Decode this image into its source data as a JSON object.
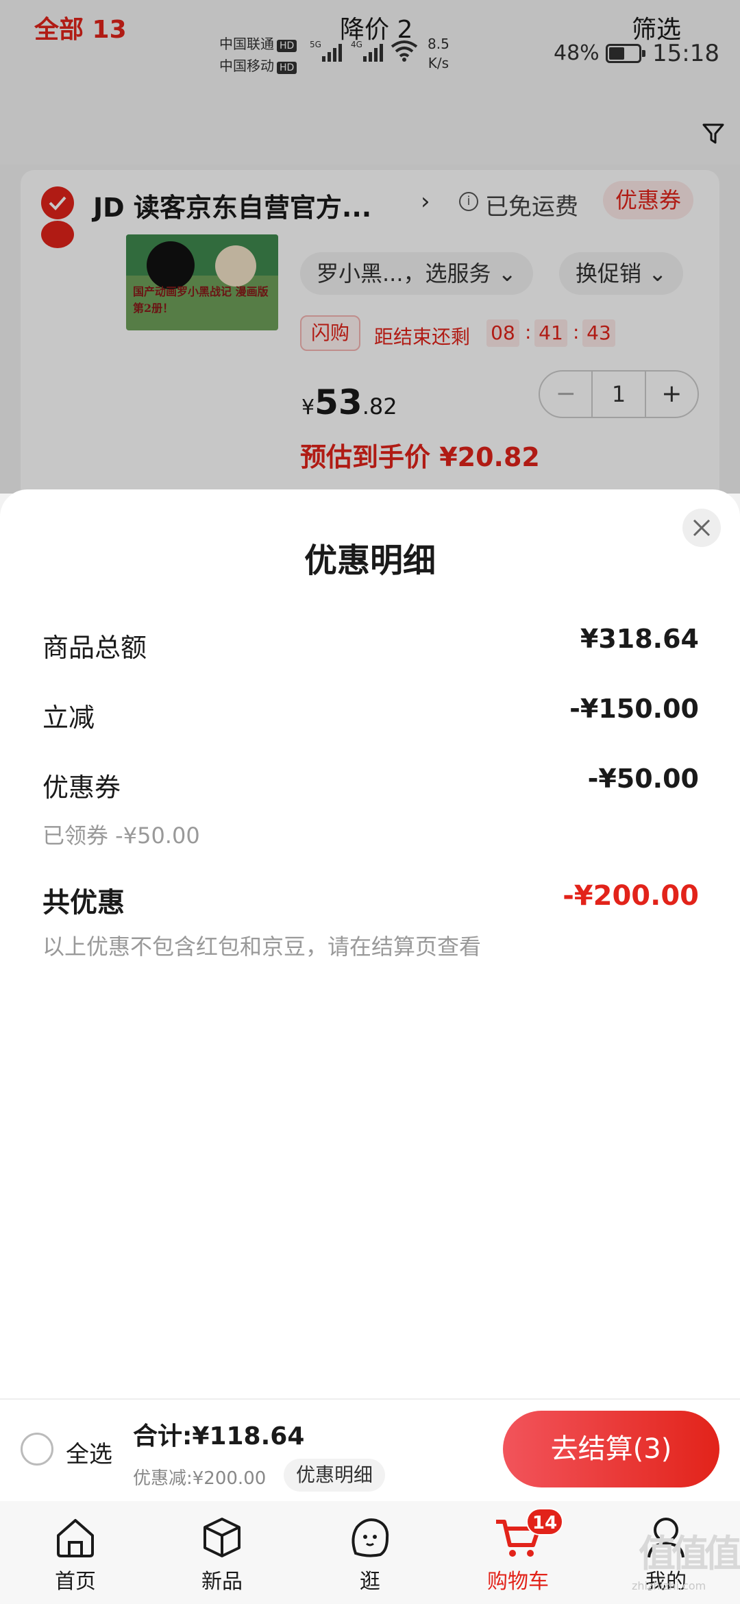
{
  "status_bar": {
    "carrier_1": "中国联通",
    "carrier_2": "中国移动",
    "hd": "HD",
    "net_1": "5G",
    "net_2": "4G",
    "speed_value": "8.5",
    "speed_unit": "K/s",
    "battery": "48%",
    "time": "15:18"
  },
  "tabs": {
    "all": "全部 13",
    "price_drop": "降价 2",
    "filter": "筛选"
  },
  "store": {
    "logo": "JD",
    "name": "读客京东自营官方...",
    "arrow": "›",
    "free_shipping": "已免运费",
    "coupon": "优惠券"
  },
  "item": {
    "cover_text": "国产动画罗小黑战记 漫画版第2册！",
    "service_select": "罗小黑...，选服务",
    "promo_select": "换促销",
    "flash_tag": "闪购",
    "countdown_label": "距结束还剩",
    "countdown": [
      "08",
      "41",
      "43"
    ],
    "price_currency": "¥",
    "price_int": "53",
    "price_dec": ".82",
    "quantity": "1",
    "minus": "−",
    "plus": "+",
    "estimated": "预估到手价 ¥20.82"
  },
  "sheet": {
    "title": "优惠明细",
    "rows": [
      {
        "label": "商品总额",
        "value": "¥318.64"
      },
      {
        "label": "立减",
        "value": "-¥150.00"
      },
      {
        "label": "优惠券",
        "value": "-¥50.00",
        "sub": "已领券 -¥50.00"
      }
    ],
    "total_label": "共优惠",
    "total_value": "-¥200.00",
    "note": "以上优惠不包含红包和京豆，请在结算页查看"
  },
  "checkout": {
    "select_all": "全选",
    "sum": "合计:¥118.64",
    "discount": "优惠减:¥200.00",
    "detail": "优惠明细",
    "go": "去结算(3)"
  },
  "nav": {
    "items": [
      {
        "label": "首页",
        "icon": "home-icon"
      },
      {
        "label": "新品",
        "icon": "box-icon"
      },
      {
        "label": "逛",
        "icon": "stroll-icon"
      },
      {
        "label": "购物车",
        "icon": "cart-icon",
        "badge": "14"
      },
      {
        "label": "我的",
        "icon": "profile-icon"
      }
    ]
  },
  "watermark": {
    "logo": "值值值",
    "text": "zhizhizhi.com"
  },
  "colors": {
    "accent": "#e2231a",
    "accent_light": "#fde9e8",
    "text_muted": "#999999"
  }
}
